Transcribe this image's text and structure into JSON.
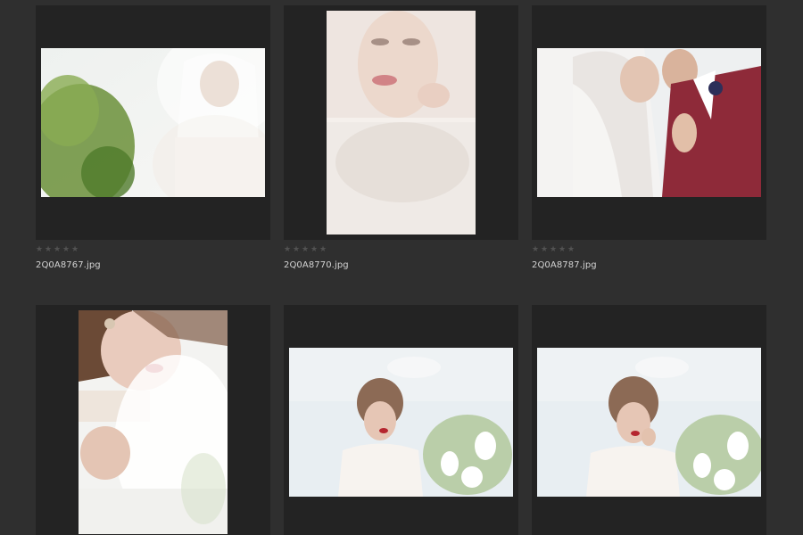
{
  "gallery": {
    "items": [
      {
        "filename": "2Q0A8767.jpg",
        "orientation": "landscape",
        "rating": 0,
        "theme": "bride-veil-greenery"
      },
      {
        "filename": "2Q0A8770.jpg",
        "orientation": "portrait",
        "rating": 0,
        "theme": "bride-veil-closeup"
      },
      {
        "filename": "2Q0A8787.jpg",
        "orientation": "landscape",
        "rating": 0,
        "theme": "bride-groom-red-suit"
      },
      {
        "filename": "",
        "orientation": "portrait",
        "rating": 0,
        "theme": "bride-profile-red-lips"
      },
      {
        "filename": "",
        "orientation": "landscape",
        "rating": 0,
        "theme": "bride-birdcage-veil-lilies"
      },
      {
        "filename": "",
        "orientation": "landscape",
        "rating": 0,
        "theme": "bride-birdcage-veil-lilies-2"
      }
    ],
    "star_glyph": "★",
    "max_stars": 5
  },
  "colors": {
    "background": "#2f2f2f",
    "tile": "#232323",
    "star_empty": "#525252",
    "filename_text": "#d3d3d3"
  }
}
